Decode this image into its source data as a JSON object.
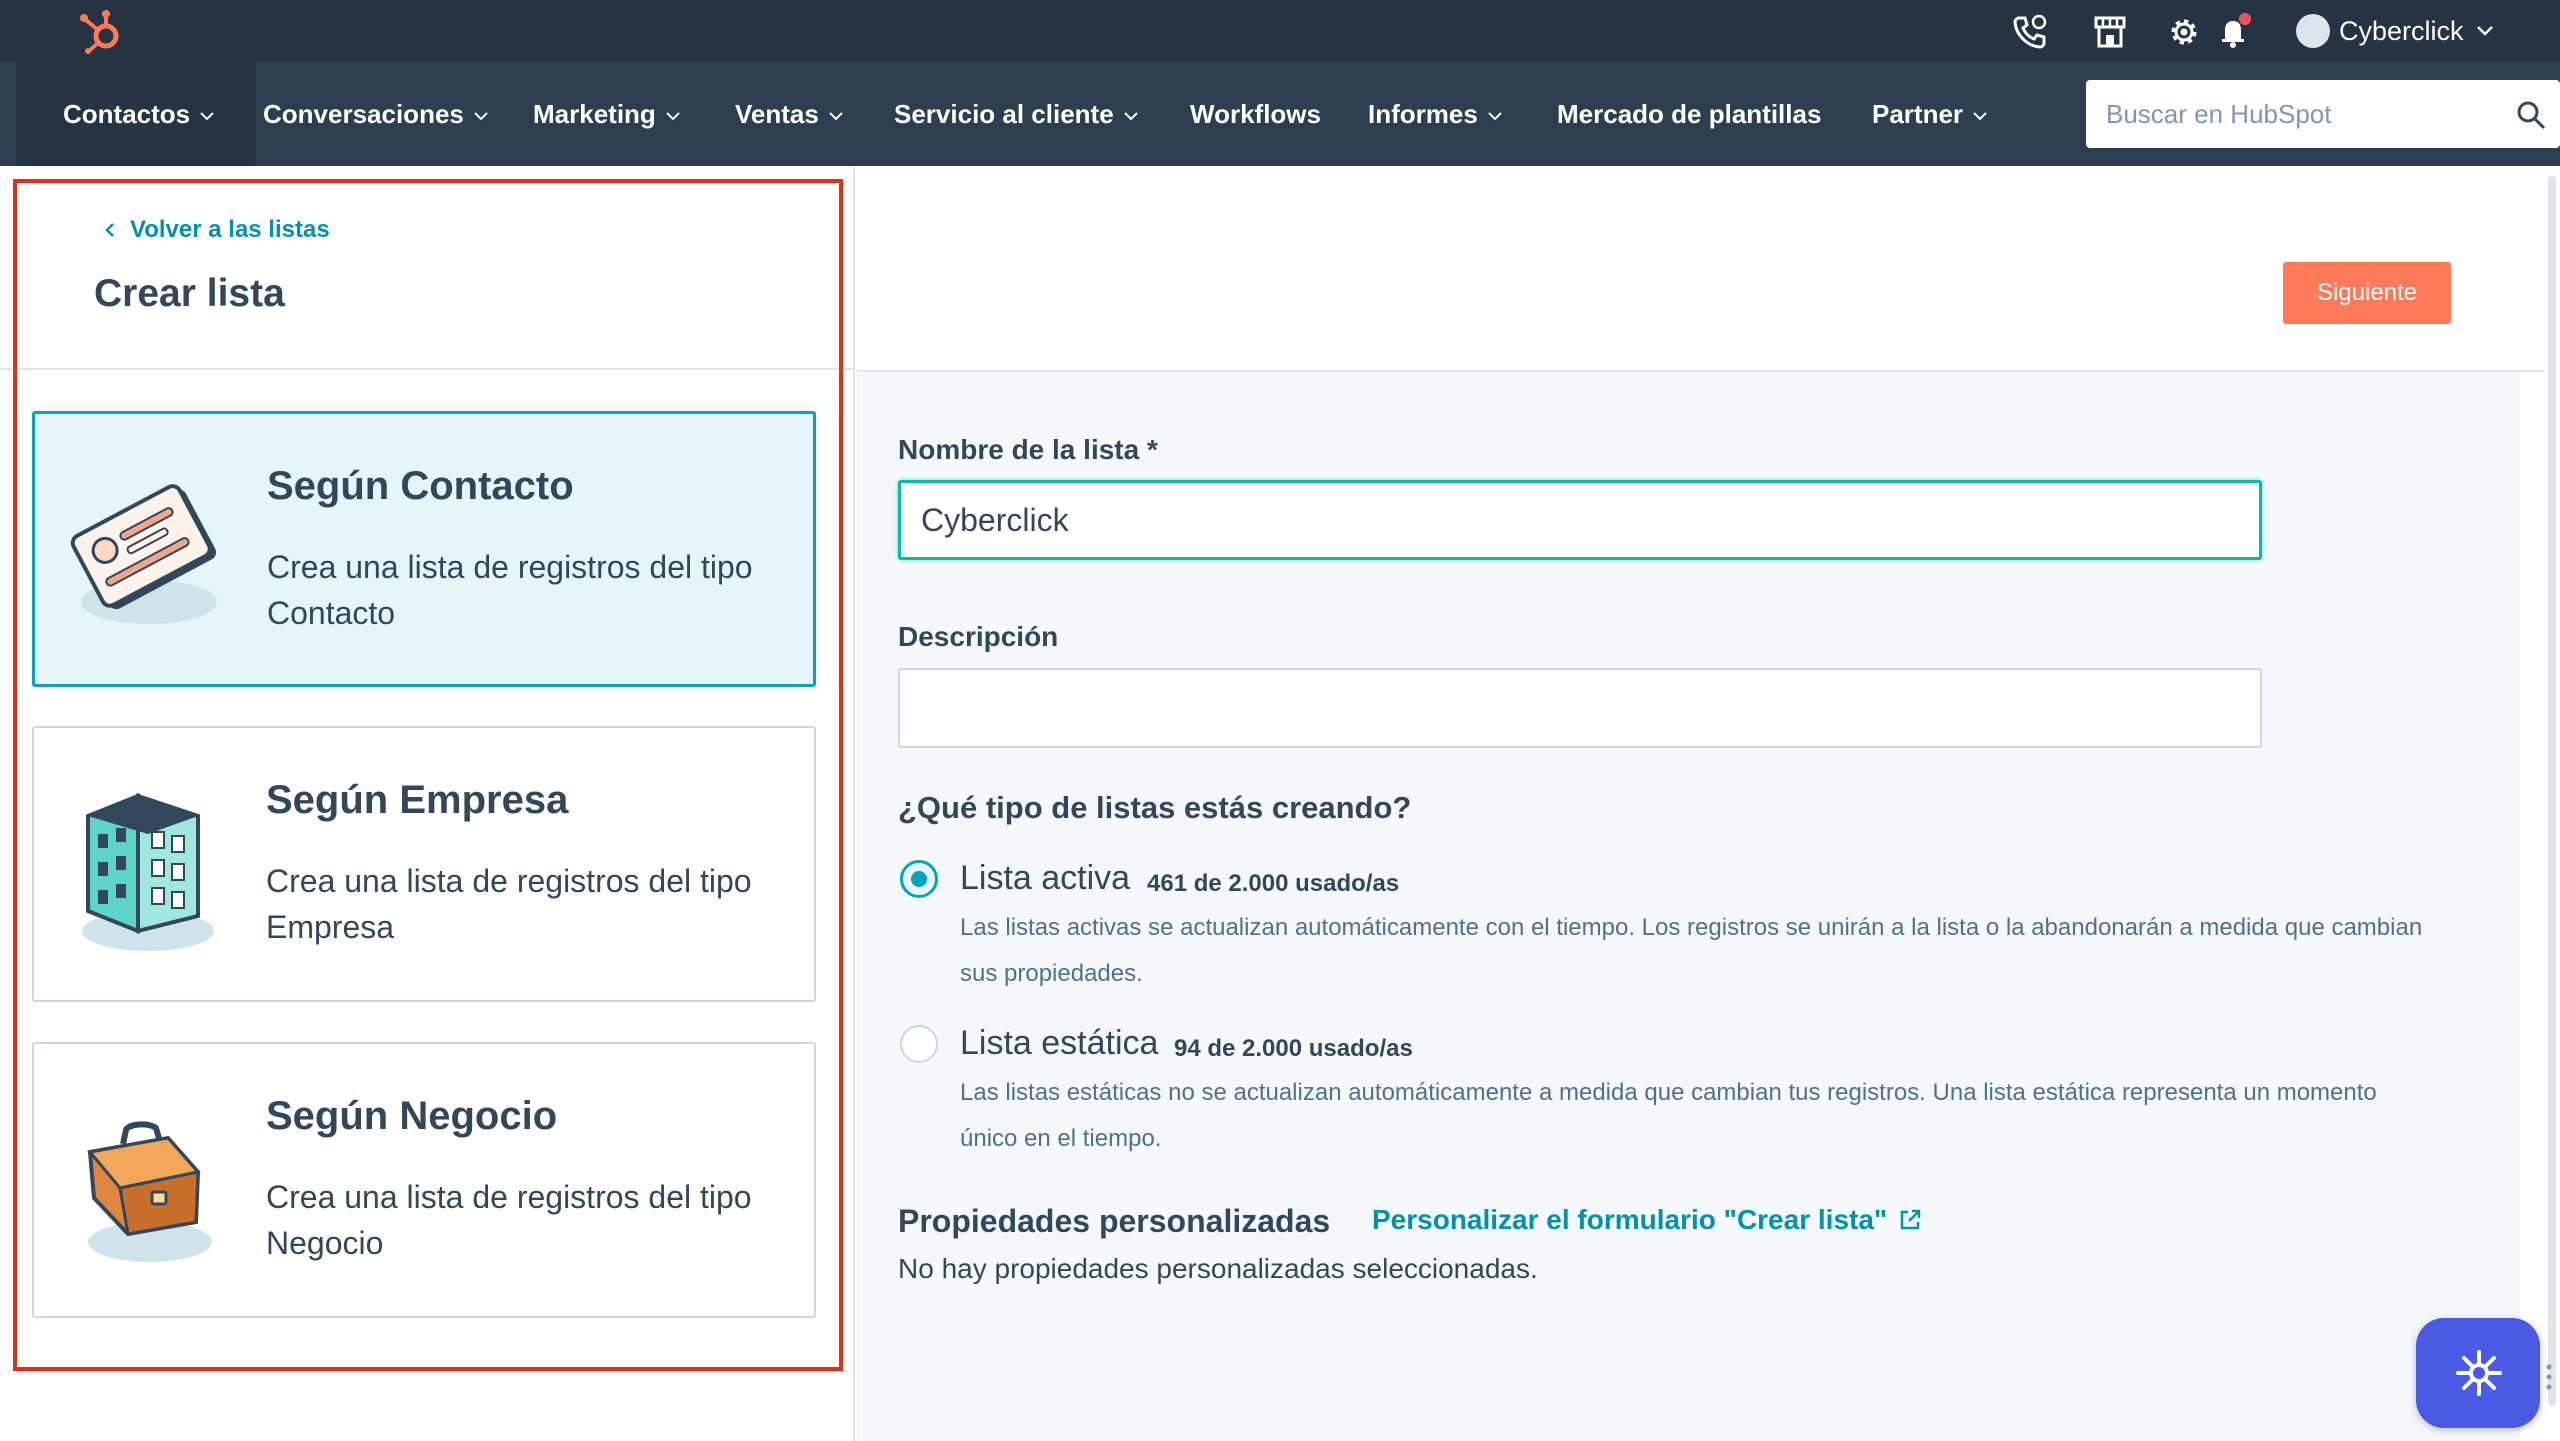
{
  "topbar": {
    "account_name": "Cyberclick"
  },
  "nav": {
    "items": [
      {
        "label": "Contactos"
      },
      {
        "label": "Conversaciones"
      },
      {
        "label": "Marketing"
      },
      {
        "label": "Ventas"
      },
      {
        "label": "Servicio al cliente"
      },
      {
        "label": "Workflows"
      },
      {
        "label": "Informes"
      },
      {
        "label": "Mercado de plantillas"
      },
      {
        "label": "Partner"
      }
    ],
    "search_placeholder": "Buscar en HubSpot"
  },
  "left": {
    "back_label": "Volver a las listas",
    "title": "Crear lista",
    "cards": [
      {
        "title": "Según Contacto",
        "desc": "Crea una lista de registros del tipo Contacto",
        "icon": "contact-card-icon"
      },
      {
        "title": "Según Empresa",
        "desc": "Crea una lista de registros del tipo Empresa",
        "icon": "building-icon"
      },
      {
        "title": "Según Negocio",
        "desc": "Crea una lista de registros del tipo Negocio",
        "icon": "briefcase-icon"
      }
    ]
  },
  "header": {
    "next_label": "Siguiente"
  },
  "form": {
    "name_label": "Nombre de la lista *",
    "name_value": "Cyberclick",
    "description_label": "Descripción",
    "description_value": "",
    "type_question": "¿Qué tipo de listas estás creando?",
    "options": [
      {
        "label": "Lista activa",
        "usage": "461 de 2.000 usado/as",
        "help": "Las listas activas se actualizan automáticamente con el tiempo. Los registros se unirán a la lista o la abandonarán a medida que cambian sus propiedades.",
        "checked": true
      },
      {
        "label": "Lista estática",
        "usage": "94 de 2.000 usado/as",
        "help": "Las listas estáticas no se actualizan automáticamente a medida que cambian tus registros. Una lista estática representa un momento único en el tiempo.",
        "checked": false
      }
    ],
    "custom_title": "Propiedades personalizadas",
    "custom_link": "Personalizar el formulario \"Crear lista\"",
    "custom_empty": "No hay propiedades personalizadas seleccionadas."
  },
  "colors": {
    "topbar": "#253342",
    "navbar": "#2d3e50",
    "accent": "#00a4bd",
    "link": "#0091ae",
    "primary_button": "#ff7a59",
    "highlight": "#e0301e",
    "chat": "#4b5ae4"
  }
}
